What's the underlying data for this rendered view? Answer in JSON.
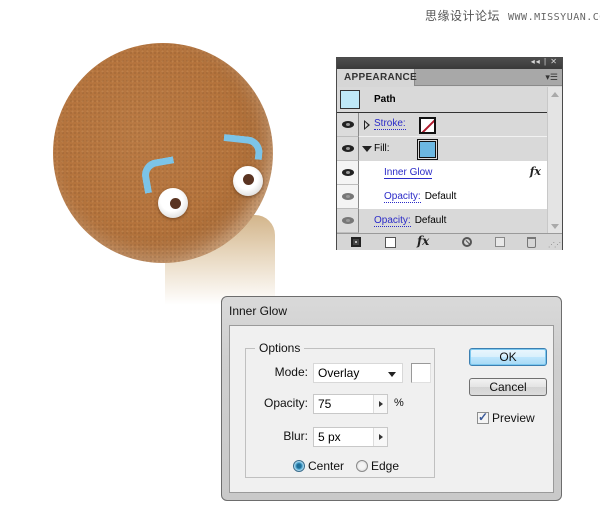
{
  "watermark": {
    "site_name": "思缘设计论坛",
    "url": "WWW.MISSYUAN.COM"
  },
  "illustration": {
    "subject": "gingerbread-man-head",
    "colors": {
      "cookie": "#b4733c",
      "icing": "#7cc4e8",
      "eye_white": "#ffffff",
      "pupil": "#5a3422"
    }
  },
  "appearance_panel": {
    "title_controls": {
      "collapse": "◂◂",
      "close": "✕"
    },
    "tab_label": "APPEARANCE",
    "menu_icon": "panel-menu-icon",
    "path_label": "Path",
    "path_swatch_color": "#bfe9f8",
    "rows": {
      "stroke": {
        "label": "Stroke:",
        "swatch": "none"
      },
      "fill": {
        "label": "Fill:",
        "swatch_color": "#6cb8e2"
      },
      "inner_glow": {
        "label": "Inner Glow",
        "fx": "fx"
      },
      "fill_opacity": {
        "label": "Opacity:",
        "value": "Default"
      },
      "object_opacity": {
        "label": "Opacity:",
        "value": "Default"
      }
    },
    "footer": {
      "fx_label": "fx",
      "icons": [
        "add-new-stroke-icon",
        "add-new-fill-icon",
        "add-new-effect-icon",
        "clear-appearance-icon",
        "duplicate-item-icon",
        "delete-item-icon"
      ]
    }
  },
  "inner_glow_dialog": {
    "title": "Inner Glow",
    "options_legend": "Options",
    "mode": {
      "label": "Mode:",
      "value": "Overlay",
      "color": "#ffffff"
    },
    "opacity": {
      "label": "Opacity:",
      "value": "75",
      "unit": "%"
    },
    "blur": {
      "label": "Blur:",
      "value": "5 px"
    },
    "source": {
      "center_label": "Center",
      "edge_label": "Edge",
      "selected": "Center"
    },
    "buttons": {
      "ok": "OK",
      "cancel": "Cancel"
    },
    "preview": {
      "label": "Preview",
      "checked": true
    }
  }
}
